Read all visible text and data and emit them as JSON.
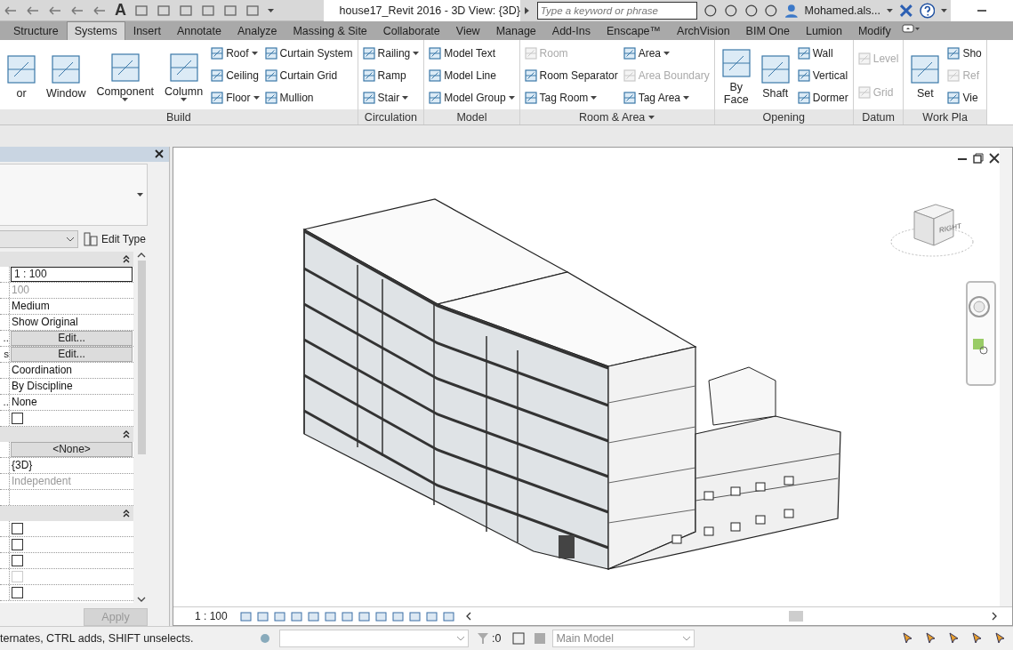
{
  "quick_access": {
    "text_tool": "A"
  },
  "title": "house17_Revit 2016 - 3D View: {3D}",
  "search": {
    "placeholder": "Type a keyword or phrase"
  },
  "user": {
    "name": "Mohamed.als..."
  },
  "tabs": [
    {
      "label": "Structure",
      "selected": false
    },
    {
      "label": "Systems",
      "selected": true
    },
    {
      "label": "Insert",
      "selected": false
    },
    {
      "label": "Annotate",
      "selected": false
    },
    {
      "label": "Analyze",
      "selected": false
    },
    {
      "label": "Massing & Site",
      "selected": false
    },
    {
      "label": "Collaborate",
      "selected": false
    },
    {
      "label": "View",
      "selected": false
    },
    {
      "label": "Manage",
      "selected": false
    },
    {
      "label": "Add-Ins",
      "selected": false
    },
    {
      "label": "Enscape™",
      "selected": false
    },
    {
      "label": "ArchVision",
      "selected": false
    },
    {
      "label": "BIM One",
      "selected": false
    },
    {
      "label": "Lumion",
      "selected": false
    },
    {
      "label": "Modify",
      "selected": false
    }
  ],
  "ribbon": {
    "panels": [
      {
        "title": "Build",
        "dropdown": false,
        "columns": [
          [
            {
              "label": "or",
              "kind": "large",
              "dropdown": false,
              "disabled": false
            }
          ],
          [
            {
              "label": "Window",
              "kind": "large",
              "dropdown": false,
              "disabled": false
            }
          ],
          [
            {
              "label": "Component",
              "kind": "large",
              "dropdown": true,
              "disabled": false
            }
          ],
          [
            {
              "label": "Column",
              "kind": "large",
              "dropdown": true,
              "disabled": false
            }
          ],
          [
            {
              "label": "Roof",
              "kind": "small",
              "dropdown": true,
              "disabled": false
            },
            {
              "label": "Ceiling",
              "kind": "small",
              "dropdown": false,
              "disabled": false
            },
            {
              "label": "Floor",
              "kind": "small",
              "dropdown": true,
              "disabled": false
            }
          ],
          [
            {
              "label": "Curtain System",
              "kind": "small",
              "dropdown": false,
              "disabled": false
            },
            {
              "label": "Curtain Grid",
              "kind": "small",
              "dropdown": false,
              "disabled": false
            },
            {
              "label": "Mullion",
              "kind": "small",
              "dropdown": false,
              "disabled": false
            }
          ]
        ]
      },
      {
        "title": "Circulation",
        "dropdown": false,
        "columns": [
          [
            {
              "label": "Railing",
              "kind": "small",
              "dropdown": true,
              "disabled": false
            },
            {
              "label": "Ramp",
              "kind": "small",
              "dropdown": false,
              "disabled": false
            },
            {
              "label": "Stair",
              "kind": "small",
              "dropdown": true,
              "disabled": false
            }
          ]
        ]
      },
      {
        "title": "Model",
        "dropdown": false,
        "columns": [
          [
            {
              "label": "Model Text",
              "kind": "small",
              "dropdown": false,
              "disabled": false
            },
            {
              "label": "Model Line",
              "kind": "small",
              "dropdown": false,
              "disabled": false
            },
            {
              "label": "Model Group",
              "kind": "small",
              "dropdown": true,
              "disabled": false
            }
          ]
        ]
      },
      {
        "title": "Room & Area",
        "dropdown": true,
        "columns": [
          [
            {
              "label": "Room",
              "kind": "small",
              "dropdown": false,
              "disabled": true
            },
            {
              "label": "Room Separator",
              "kind": "small",
              "dropdown": false,
              "disabled": false
            },
            {
              "label": "Tag Room",
              "kind": "small",
              "dropdown": true,
              "disabled": false
            }
          ],
          [
            {
              "label": "Area",
              "kind": "small",
              "dropdown": true,
              "disabled": false
            },
            {
              "label": "Area Boundary",
              "kind": "small",
              "dropdown": false,
              "disabled": true
            },
            {
              "label": "Tag Area",
              "kind": "small",
              "dropdown": true,
              "disabled": false
            }
          ]
        ]
      },
      {
        "title": "Opening",
        "dropdown": false,
        "columns": [
          [
            {
              "label": "By Face",
              "kind": "large",
              "dropdown": false,
              "disabled": false
            }
          ],
          [
            {
              "label": "Shaft",
              "kind": "large",
              "dropdown": false,
              "disabled": false
            }
          ],
          [
            {
              "label": "Wall",
              "kind": "small",
              "dropdown": false,
              "disabled": false
            },
            {
              "label": "Vertical",
              "kind": "small",
              "dropdown": false,
              "disabled": false
            },
            {
              "label": "Dormer",
              "kind": "small",
              "dropdown": false,
              "disabled": false
            }
          ]
        ]
      },
      {
        "title": "Datum",
        "dropdown": false,
        "columns": [
          [
            {
              "label": "Level",
              "kind": "small",
              "dropdown": false,
              "disabled": true
            },
            {
              "label": "Grid",
              "kind": "small",
              "dropdown": false,
              "disabled": true
            }
          ]
        ]
      },
      {
        "title": "Work Pla",
        "dropdown": false,
        "columns": [
          [
            {
              "label": "Set",
              "kind": "large",
              "dropdown": false,
              "disabled": false
            }
          ],
          [
            {
              "label": "Sho",
              "kind": "small",
              "dropdown": false,
              "disabled": false
            },
            {
              "label": "Ref",
              "kind": "small",
              "dropdown": false,
              "disabled": true
            },
            {
              "label": "Vie",
              "kind": "small",
              "dropdown": false,
              "disabled": false
            }
          ]
        ]
      }
    ]
  },
  "properties": {
    "edit_type": "Edit Type",
    "sections": [
      {
        "rows": [
          {
            "kind": "field",
            "value": "1 : 100"
          },
          {
            "kind": "muted",
            "value": "100"
          },
          {
            "kind": "text",
            "value": "Medium"
          },
          {
            "kind": "text",
            "value": "Show Original"
          },
          {
            "label": "..",
            "kind": "button",
            "value": "Edit..."
          },
          {
            "label": "s",
            "kind": "button",
            "value": "Edit..."
          },
          {
            "kind": "text",
            "value": "Coordination"
          },
          {
            "kind": "text",
            "value": "By Discipline"
          },
          {
            "label": "..",
            "kind": "text",
            "value": "None"
          },
          {
            "kind": "checkbox",
            "checked": false,
            "disabled": false
          }
        ]
      },
      {
        "rows": [
          {
            "kind": "button",
            "value": "<None>"
          },
          {
            "kind": "text",
            "value": "{3D}"
          },
          {
            "kind": "muted",
            "value": "Independent"
          },
          {
            "kind": "empty"
          }
        ]
      },
      {
        "rows": [
          {
            "kind": "checkbox",
            "checked": false,
            "disabled": false
          },
          {
            "kind": "checkbox",
            "checked": false,
            "disabled": false
          },
          {
            "kind": "checkbox",
            "checked": false,
            "disabled": false
          },
          {
            "kind": "checkbox",
            "checked": false,
            "disabled": true
          },
          {
            "kind": "checkbox",
            "checked": false,
            "disabled": false
          }
        ]
      }
    ],
    "apply": "Apply"
  },
  "view": {
    "cube_face": "RIGHT",
    "scale": "1 : 100"
  },
  "status_bar": {
    "message": "ternates, CTRL adds, SHIFT unselects.",
    "count": ":0",
    "model": "Main Model"
  }
}
